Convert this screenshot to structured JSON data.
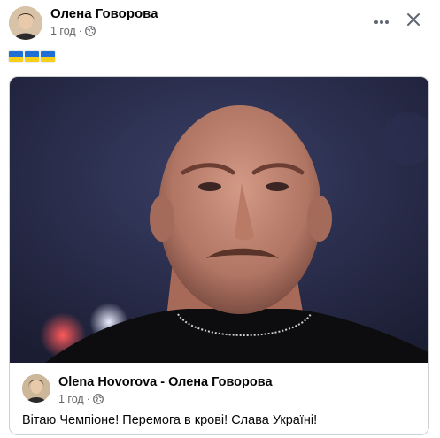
{
  "post": {
    "author": "Олена Говорова",
    "time": "1 год",
    "separator": "·",
    "visibility_icon": "globe-icon",
    "flags": [
      "ukraine-flag",
      "ukraine-flag",
      "ukraine-flag"
    ],
    "actions": {
      "more_icon": "more-options-icon",
      "close_icon": "close-icon"
    }
  },
  "shared": {
    "photo_subject": "photo",
    "author": "Olena Hovorova - Олена Говорова",
    "time": "1 год",
    "separator": "·",
    "visibility_icon": "globe-icon",
    "text": "Вітаю Чемпіоне! Перемога в крові! Слава Україні!"
  },
  "colors": {
    "text_primary": "#050505",
    "text_secondary": "#65676b",
    "border": "#ced0d4",
    "flag_blue": "#1f6fd6",
    "flag_yellow": "#f6cf1a"
  }
}
